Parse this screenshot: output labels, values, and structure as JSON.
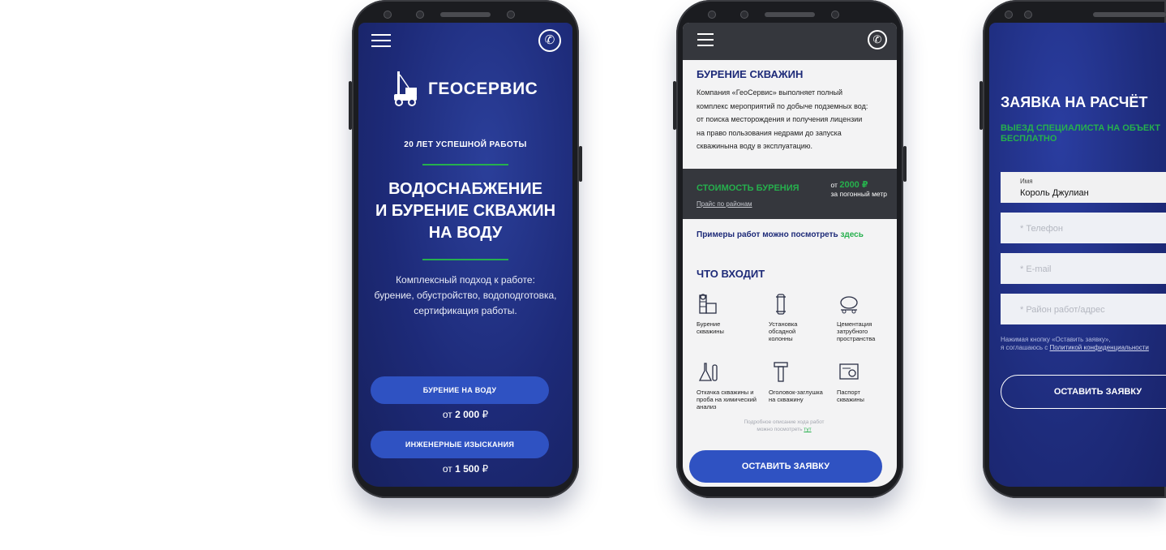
{
  "phone1": {
    "brand": "ГЕОСЕРВИС",
    "tagline": "20 ЛЕТ УСПЕШНОЙ РАБОТЫ",
    "headline": [
      "ВОДОСНАБЖЕНИЕ",
      "И БУРЕНИЕ СКВАЖИН",
      "НА ВОДУ"
    ],
    "description": [
      "Комплексный подход к работе:",
      "бурение, обустройство, водоподготовка,",
      "сертификация работы."
    ],
    "buttons": [
      {
        "label": "БУРЕНИЕ НА ВОДУ",
        "price_prefix": "от",
        "price": "2 000",
        "currency": "₽"
      },
      {
        "label": "ИНЖЕНЕРНЫЕ ИЗЫСКАНИЯ",
        "price_prefix": "от",
        "price": "1 500",
        "currency": "₽"
      }
    ]
  },
  "phone2": {
    "section_title": "БУРЕНИЕ СКВАЖИН",
    "about": [
      "Компания «ГеоСервис» выполняет полный",
      "комплекс мероприятий по добыче подземных вод:",
      "от поиска месторождения и получения лицензии",
      "на право пользования недрами до запуска",
      "скважинына воду в эксплуатацию."
    ],
    "cost": {
      "title": "СТОИМОСТЬ БУРЕНИЯ",
      "link": "Прайс по районам",
      "prefix": "от",
      "value": "2000 ₽",
      "unit": "за погонный метр"
    },
    "examples": {
      "text": "Примеры работ можно посмотреть",
      "link": "здесь"
    },
    "includes_title": "ЧТО ВХОДИТ",
    "services": [
      {
        "label": [
          "Бурение",
          "скважины"
        ],
        "icon": "drill-rig-icon"
      },
      {
        "label": [
          "Установка",
          "обсадной",
          "колонны"
        ],
        "icon": "casing-pipe-icon"
      },
      {
        "label": [
          "Цементация",
          "затрубного",
          "пространства"
        ],
        "icon": "cement-mixer-icon"
      },
      {
        "label": [
          "Откачка скважины и",
          "проба на химический",
          "анализ"
        ],
        "icon": "flask-icon"
      },
      {
        "label": [
          "Оголовок-заглушка",
          "на скважину"
        ],
        "icon": "well-cap-icon"
      },
      {
        "label": [
          "Паспорт",
          "скважины"
        ],
        "icon": "certificate-icon"
      }
    ],
    "footnote": {
      "line1": "Подробное описание хода работ",
      "line2": "можно посмотреть",
      "link": "тут"
    },
    "cta": "ОСТАВИТЬ ЗАЯВКУ"
  },
  "phone3": {
    "title": "ЗАЯВКА НА РАСЧЁТ",
    "subtitle": [
      "ВЫЕЗД СПЕЦИАЛИСТА НА ОБЪЕКТ",
      "БЕСПЛАТНО"
    ],
    "fields": [
      {
        "label": "Имя",
        "value": "Король Джулиан",
        "placeholder": ""
      },
      {
        "label": "",
        "value": "",
        "placeholder": "* Телефон"
      },
      {
        "label": "",
        "value": "",
        "placeholder": "* E-mail"
      },
      {
        "label": "",
        "value": "",
        "placeholder": "* Район работ/адрес"
      }
    ],
    "consent": {
      "line1": "Нажимая кнопку «Оставить заявку»,",
      "line2_prefix": "я соглашаюсь с",
      "link": "Политикой конфиденциальности"
    },
    "cta": "ОСТАВИТЬ ЗАЯВКУ"
  },
  "colors": {
    "navy": "#1d2a78",
    "button_blue": "#2f52c2",
    "green": "#26b04d",
    "dark_header": "#35373d"
  }
}
